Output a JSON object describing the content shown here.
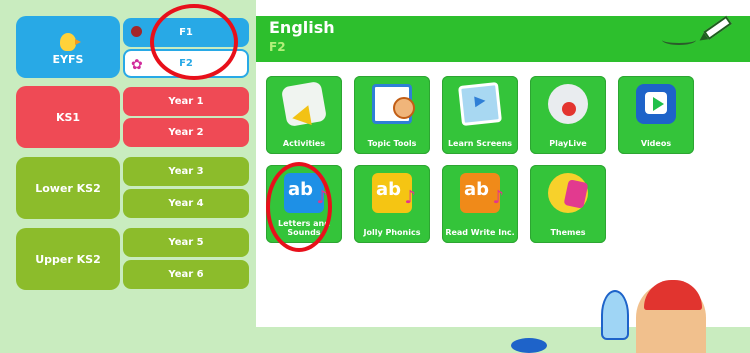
{
  "sidebar": {
    "eyfs": {
      "label": "EYFS",
      "subs": [
        {
          "label": "F1"
        },
        {
          "label": "F2"
        }
      ]
    },
    "ks1": {
      "label": "KS1",
      "subs": [
        {
          "label": "Year 1"
        },
        {
          "label": "Year 2"
        }
      ]
    },
    "lower_ks2": {
      "label": "Lower KS2",
      "subs": [
        {
          "label": "Year 3"
        },
        {
          "label": "Year 4"
        }
      ]
    },
    "upper_ks2": {
      "label": "Upper KS2",
      "subs": [
        {
          "label": "Year 5"
        },
        {
          "label": "Year 6"
        }
      ]
    }
  },
  "header": {
    "title": "English",
    "subtitle": "F2"
  },
  "tiles": [
    {
      "label": "Activities"
    },
    {
      "label": "Topic Tools"
    },
    {
      "label": "Learn Screens"
    },
    {
      "label": "PlayLive"
    },
    {
      "label": "Videos"
    },
    {
      "label": "Letters and Sounds",
      "icon_text": "ab"
    },
    {
      "label": "Jolly Phonics",
      "icon_text": "ab"
    },
    {
      "label": "Read Write Inc.",
      "icon_text": "ab"
    },
    {
      "label": "Themes"
    }
  ],
  "colors": {
    "eyfs": "#28a9e6",
    "ks1": "#ef4a55",
    "ks2": "#8cbc2b",
    "header": "#2dbf2d",
    "tile": "#34c43a",
    "highlight": "#e8101b"
  }
}
